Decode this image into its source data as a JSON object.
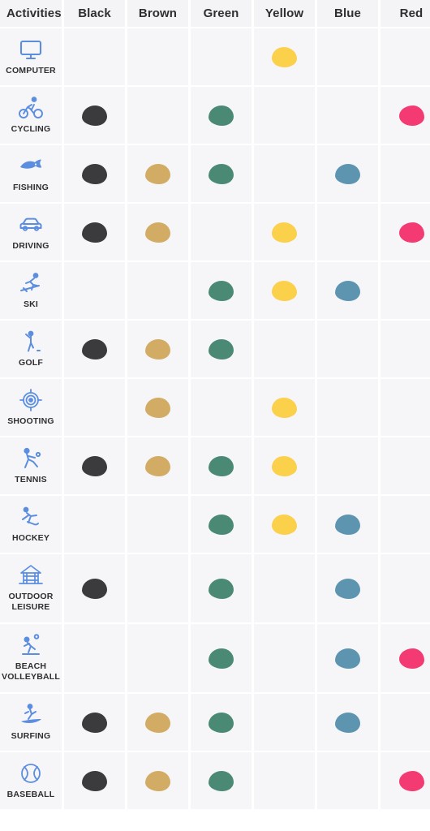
{
  "table": {
    "columns": [
      {
        "key": "activities",
        "label": "Activities"
      },
      {
        "key": "black",
        "label": "Black",
        "color": "#3b3a3c"
      },
      {
        "key": "brown",
        "label": "Brown",
        "color": "#d2ac64"
      },
      {
        "key": "green",
        "label": "Green",
        "color": "#4a8a74"
      },
      {
        "key": "yellow",
        "label": "Yellow",
        "color": "#fbd04a"
      },
      {
        "key": "blue",
        "label": "Blue",
        "color": "#5d95b0"
      },
      {
        "key": "red",
        "label": "Red",
        "color": "#f43a72"
      }
    ],
    "rows": [
      {
        "label": "COMPUTER",
        "icon": "monitor-icon",
        "marks": {
          "black": false,
          "brown": false,
          "green": false,
          "yellow": true,
          "blue": false,
          "red": false
        }
      },
      {
        "label": "CYCLING",
        "icon": "cyclist-icon",
        "marks": {
          "black": true,
          "brown": false,
          "green": true,
          "yellow": false,
          "blue": false,
          "red": true
        }
      },
      {
        "label": "FISHING",
        "icon": "fish-icon",
        "marks": {
          "black": true,
          "brown": true,
          "green": true,
          "yellow": false,
          "blue": true,
          "red": false
        }
      },
      {
        "label": "DRIVING",
        "icon": "car-icon",
        "marks": {
          "black": true,
          "brown": true,
          "green": false,
          "yellow": true,
          "blue": false,
          "red": true
        }
      },
      {
        "label": "SKI",
        "icon": "skier-icon",
        "marks": {
          "black": false,
          "brown": false,
          "green": true,
          "yellow": true,
          "blue": true,
          "red": false
        }
      },
      {
        "label": "GOLF",
        "icon": "golfer-icon",
        "marks": {
          "black": true,
          "brown": true,
          "green": true,
          "yellow": false,
          "blue": false,
          "red": false
        }
      },
      {
        "label": "SHOOTING",
        "icon": "target-icon",
        "marks": {
          "black": false,
          "brown": true,
          "green": false,
          "yellow": true,
          "blue": false,
          "red": false
        }
      },
      {
        "label": "TENNIS",
        "icon": "tennis-icon",
        "marks": {
          "black": true,
          "brown": true,
          "green": true,
          "yellow": true,
          "blue": false,
          "red": false
        }
      },
      {
        "label": "HOCKEY",
        "icon": "hockey-icon",
        "marks": {
          "black": false,
          "brown": false,
          "green": true,
          "yellow": true,
          "blue": true,
          "red": false
        }
      },
      {
        "label": "OUTDOOR LEISURE",
        "icon": "gazebo-icon",
        "marks": {
          "black": true,
          "brown": false,
          "green": true,
          "yellow": false,
          "blue": true,
          "red": false
        }
      },
      {
        "label": "BEACH VOLLEYBALL",
        "icon": "volleyball-icon",
        "marks": {
          "black": false,
          "brown": false,
          "green": true,
          "yellow": false,
          "blue": true,
          "red": true
        }
      },
      {
        "label": "SURFING",
        "icon": "surfer-icon",
        "marks": {
          "black": true,
          "brown": true,
          "green": true,
          "yellow": false,
          "blue": true,
          "red": false
        }
      },
      {
        "label": "BASEBALL",
        "icon": "baseball-icon",
        "marks": {
          "black": true,
          "brown": true,
          "green": true,
          "yellow": false,
          "blue": false,
          "red": true
        }
      }
    ]
  }
}
